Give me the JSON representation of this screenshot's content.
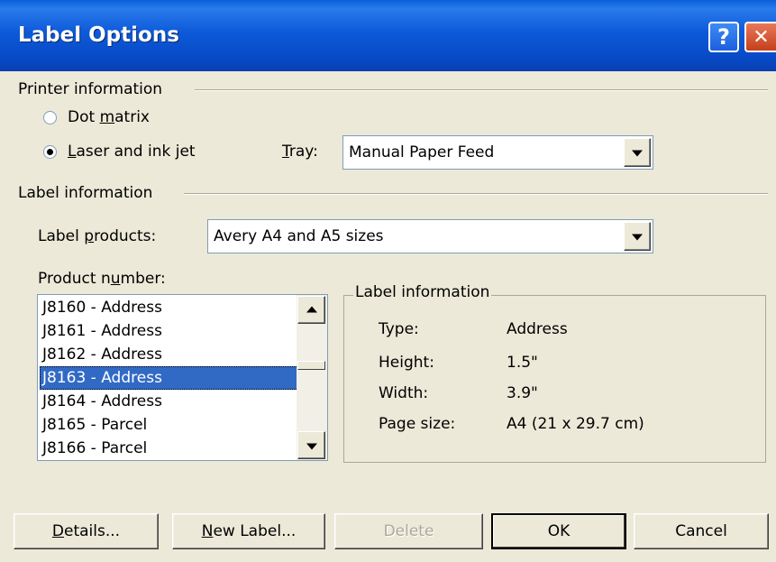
{
  "window": {
    "title": "Label Options",
    "help_glyph": "?",
    "close_glyph": "✕"
  },
  "printer": {
    "group_label": "Printer information",
    "dot_matrix": {
      "pre": "Dot ",
      "key": "m",
      "post": "atrix",
      "checked": false
    },
    "laser": {
      "pre": "",
      "key": "L",
      "post": "aser and ink jet",
      "checked": true
    },
    "tray_label": {
      "pre": "",
      "key": "T",
      "post": "ray:"
    },
    "tray_value": "Manual Paper Feed"
  },
  "label_info": {
    "group_label": "Label information",
    "products_label": {
      "pre": "Label ",
      "key": "p",
      "post": "roducts:"
    },
    "products_value": "Avery A4 and A5 sizes",
    "product_number_label": {
      "pre": "Product n",
      "key": "u",
      "post": "mber:"
    },
    "product_numbers": [
      "J8160 - Address",
      "J8161 - Address",
      "J8162 - Address",
      "J8163 - Address",
      "J8164 - Address",
      "J8165 - Parcel",
      "J8166 - Parcel"
    ],
    "selected_index": 3
  },
  "details": {
    "legend": "Label information",
    "type_key": "Type:",
    "type_val": "Address",
    "height_key": "Height:",
    "height_val": "1.5\"",
    "width_key": "Width:",
    "width_val": "3.9\"",
    "pagesize_key": "Page size:",
    "pagesize_val": "A4 (21 x 29.7 cm)"
  },
  "buttons": {
    "details": {
      "pre": "",
      "key": "D",
      "post": "etails..."
    },
    "new_label": {
      "pre": "",
      "key": "N",
      "post": "ew Label..."
    },
    "delete": "Delete",
    "ok": "OK",
    "cancel": "Cancel"
  }
}
